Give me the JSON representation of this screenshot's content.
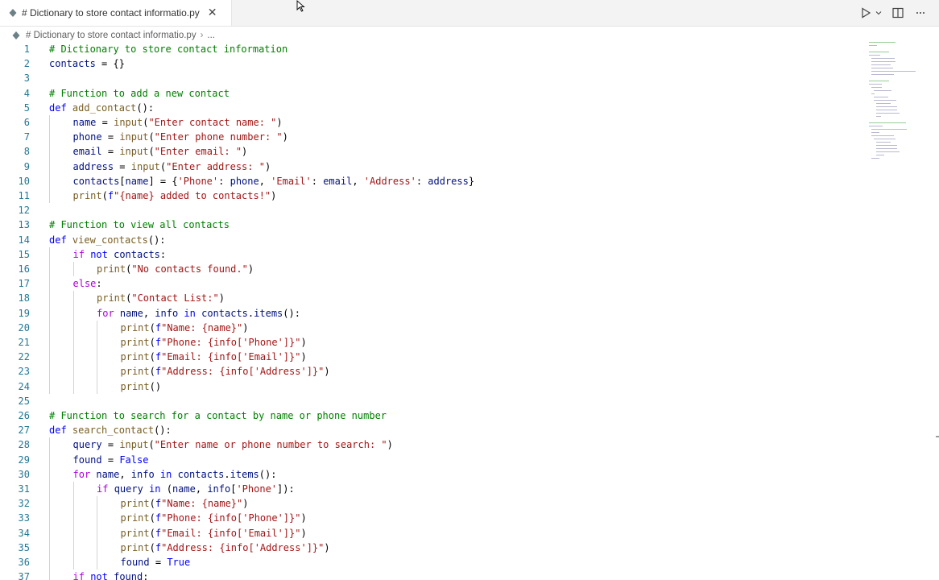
{
  "tab": {
    "title": "# Dictionary to store contact informatio.py",
    "close_glyph": "✕",
    "icon": "python-file-icon"
  },
  "breadcrumb": {
    "file": "# Dictionary to store contact informatio.py",
    "separator": "›",
    "more": "..."
  },
  "toolbar": {
    "run_icon": "play-icon",
    "dropdown_icon": "chevron-down-icon",
    "split_icon": "split-editor-icon",
    "more_icon": "more-actions-icon"
  },
  "colors": {
    "comment": "#008000",
    "keyword": "#0000ff",
    "control": "#af00db",
    "string": "#a31515",
    "function": "#795e26",
    "variable": "#001080",
    "line_number": "#237893"
  },
  "code_lines": [
    {
      "n": "1",
      "indent": 0,
      "text": "# Dictionary to store contact information"
    },
    {
      "n": "2",
      "indent": 0,
      "text": "contacts = {}"
    },
    {
      "n": "3",
      "indent": 0,
      "text": ""
    },
    {
      "n": "4",
      "indent": 0,
      "text": "# Function to add a new contact"
    },
    {
      "n": "5",
      "indent": 0,
      "text": "def add_contact():"
    },
    {
      "n": "6",
      "indent": 1,
      "text": "name = input(\"Enter contact name: \")"
    },
    {
      "n": "7",
      "indent": 1,
      "text": "phone = input(\"Enter phone number: \")"
    },
    {
      "n": "8",
      "indent": 1,
      "text": "email = input(\"Enter email: \")"
    },
    {
      "n": "9",
      "indent": 1,
      "text": "address = input(\"Enter address: \")"
    },
    {
      "n": "10",
      "indent": 1,
      "text": "contacts[name] = {'Phone': phone, 'Email': email, 'Address': address}"
    },
    {
      "n": "11",
      "indent": 1,
      "text": "print(f\"{name} added to contacts!\")"
    },
    {
      "n": "12",
      "indent": 0,
      "text": ""
    },
    {
      "n": "13",
      "indent": 0,
      "text": "# Function to view all contacts"
    },
    {
      "n": "14",
      "indent": 0,
      "text": "def view_contacts():"
    },
    {
      "n": "15",
      "indent": 1,
      "text": "if not contacts:"
    },
    {
      "n": "16",
      "indent": 2,
      "text": "print(\"No contacts found.\")"
    },
    {
      "n": "17",
      "indent": 1,
      "text": "else:"
    },
    {
      "n": "18",
      "indent": 2,
      "text": "print(\"Contact List:\")"
    },
    {
      "n": "19",
      "indent": 2,
      "text": "for name, info in contacts.items():"
    },
    {
      "n": "20",
      "indent": 3,
      "text": "print(f\"Name: {name}\")"
    },
    {
      "n": "21",
      "indent": 3,
      "text": "print(f\"Phone: {info['Phone']}\")"
    },
    {
      "n": "22",
      "indent": 3,
      "text": "print(f\"Email: {info['Email']}\")"
    },
    {
      "n": "23",
      "indent": 3,
      "text": "print(f\"Address: {info['Address']}\")"
    },
    {
      "n": "24",
      "indent": 3,
      "text": "print()"
    },
    {
      "n": "25",
      "indent": 0,
      "text": ""
    },
    {
      "n": "26",
      "indent": 0,
      "text": "# Function to search for a contact by name or phone number"
    },
    {
      "n": "27",
      "indent": 0,
      "text": "def search_contact():"
    },
    {
      "n": "28",
      "indent": 1,
      "text": "query = input(\"Enter name or phone number to search: \")"
    },
    {
      "n": "29",
      "indent": 1,
      "text": "found = False"
    },
    {
      "n": "30",
      "indent": 1,
      "text": "for name, info in contacts.items():"
    },
    {
      "n": "31",
      "indent": 2,
      "text": "if query in (name, info['Phone']):"
    },
    {
      "n": "32",
      "indent": 3,
      "text": "print(f\"Name: {name}\")"
    },
    {
      "n": "33",
      "indent": 3,
      "text": "print(f\"Phone: {info['Phone']}\")"
    },
    {
      "n": "34",
      "indent": 3,
      "text": "print(f\"Email: {info['Email']}\")"
    },
    {
      "n": "35",
      "indent": 3,
      "text": "print(f\"Address: {info['Address']}\")"
    },
    {
      "n": "36",
      "indent": 3,
      "text": "found = True"
    },
    {
      "n": "37",
      "indent": 1,
      "text": "if not found:"
    }
  ]
}
